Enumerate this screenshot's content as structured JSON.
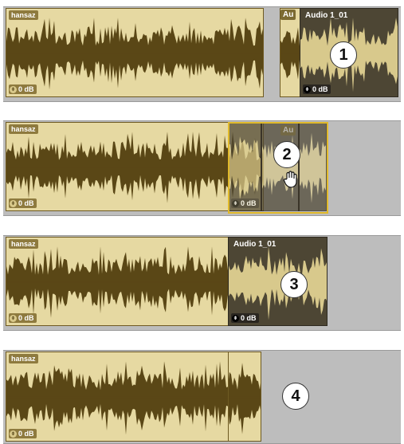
{
  "colors": {
    "waveform": "#5a4716",
    "clip_light": "#e6d9a2",
    "clip_dark": "#4d4634",
    "selection": "#e0b92a",
    "track_bg": "#bdbdbd"
  },
  "steps": [
    {
      "number": "1",
      "clips": [
        {
          "name": "hansaz",
          "gain": "0 dB"
        },
        {
          "short": "Au",
          "name": "Audio 1_01",
          "gain": "0 dB"
        }
      ]
    },
    {
      "number": "2",
      "clips": [
        {
          "name": "hansaz",
          "gain": "0 dB"
        },
        {
          "short": "Au",
          "gain": "0 dB"
        }
      ],
      "cursor": "hand-grab-icon"
    },
    {
      "number": "3",
      "clips": [
        {
          "name": "hansaz",
          "gain": "0 dB"
        },
        {
          "name": "Audio 1_01",
          "gain": "0 dB"
        }
      ]
    },
    {
      "number": "4",
      "clips": [
        {
          "name": "hansaz",
          "gain": "0 dB"
        }
      ]
    }
  ]
}
